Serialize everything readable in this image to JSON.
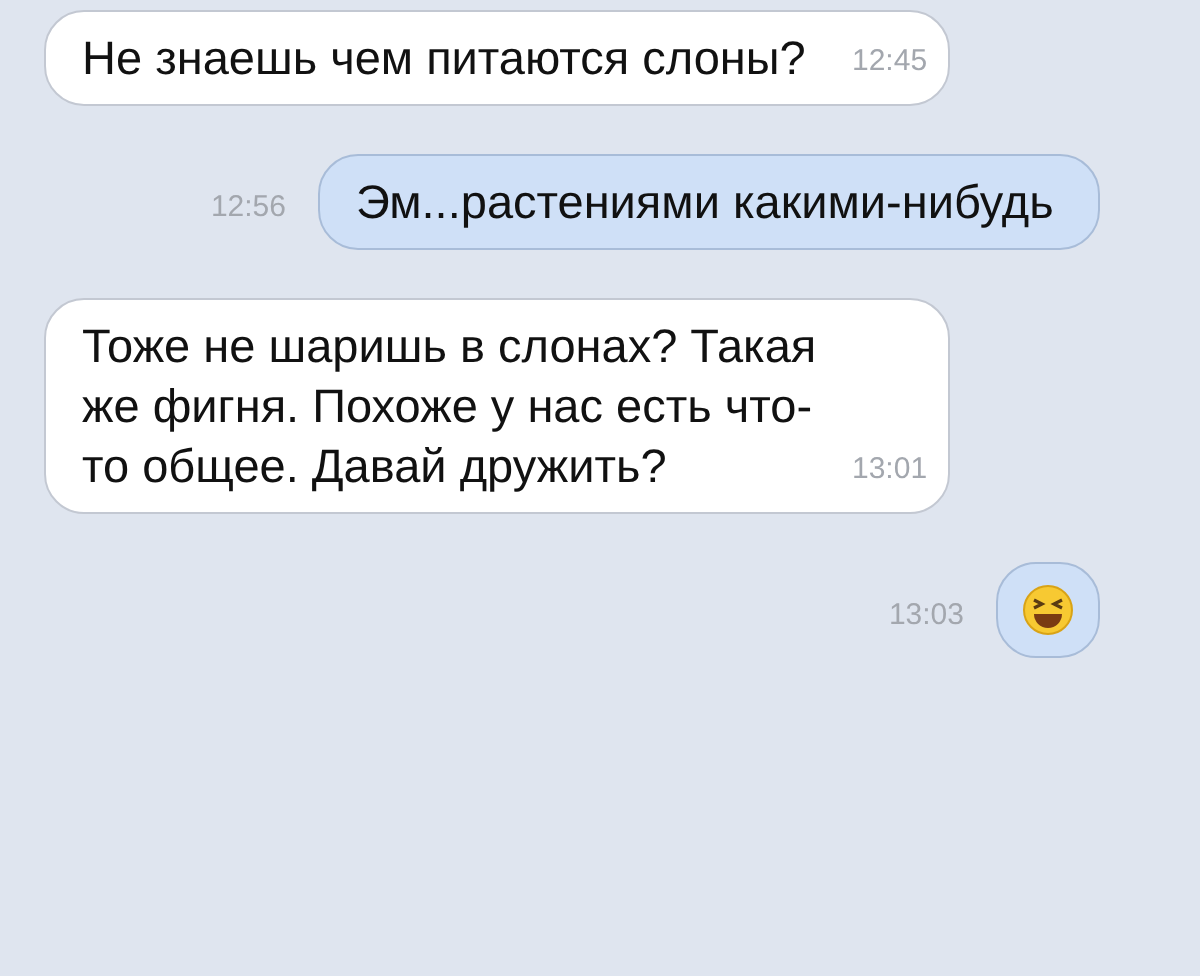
{
  "messages": [
    {
      "outgoing": false,
      "text": "Не знаешь чем питаются слоны?",
      "time": "12:45"
    },
    {
      "outgoing": true,
      "text": "Эм...растениями какими-нибудь",
      "time": "12:56"
    },
    {
      "outgoing": false,
      "text": "Тоже не шаришь в слонах? Такая же фигня. Похоже у нас есть что-то общее. Давай дружить?",
      "time": "13:01"
    },
    {
      "outgoing": true,
      "kind": "emoji",
      "time": "13:03"
    }
  ]
}
